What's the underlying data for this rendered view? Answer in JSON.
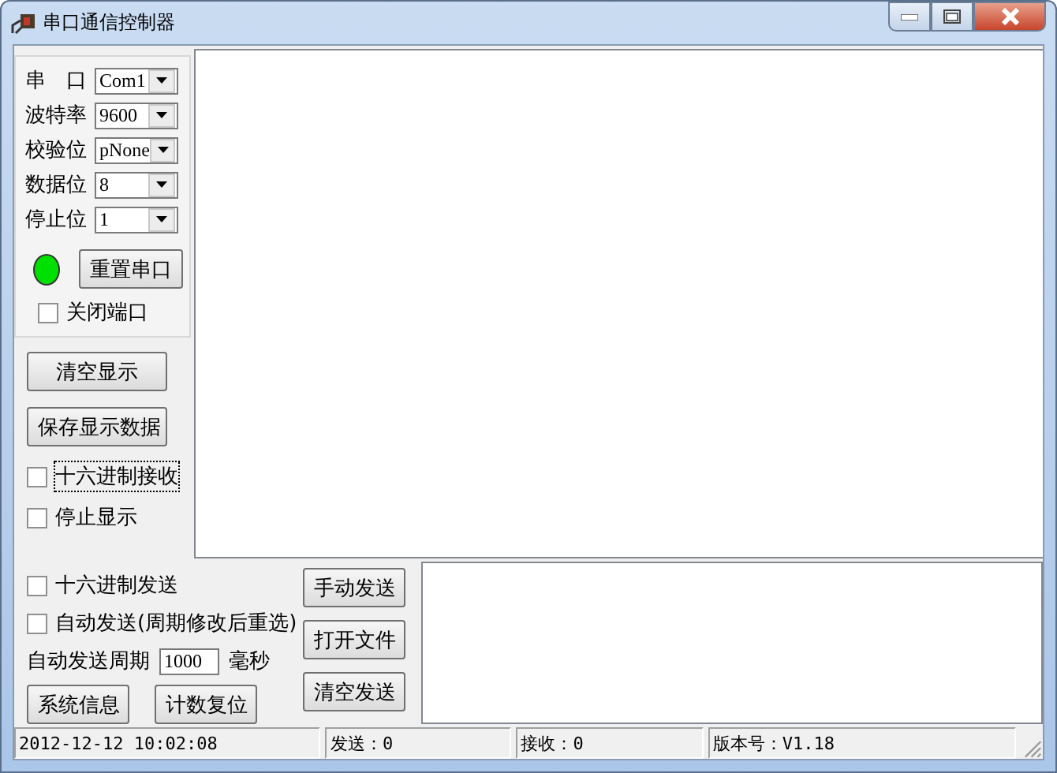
{
  "window": {
    "title": "串口通信控制器"
  },
  "serial_settings": [
    {
      "label": "串　口",
      "value": "Com1"
    },
    {
      "label": "波特率",
      "value": "9600"
    },
    {
      "label": "校验位",
      "value": "pNone"
    },
    {
      "label": "数据位",
      "value": "8"
    },
    {
      "label": "停止位",
      "value": "1"
    }
  ],
  "port_indicator": {
    "on": true
  },
  "reset_button": "重置串口",
  "close_port": {
    "label": "关闭端口",
    "checked": false
  },
  "clear_display_button": "清空显示",
  "save_display_button": "保存显示数据",
  "receive_options": [
    {
      "label": "十六进制接收",
      "checked": false,
      "focused": true
    },
    {
      "label": "停止显示",
      "checked": false,
      "focused": false
    }
  ],
  "send_options": [
    {
      "label": "十六进制发送",
      "checked": false
    },
    {
      "label": "自动发送(周期修改后重选)",
      "checked": false
    }
  ],
  "period": {
    "label": "自动发送周期",
    "value": "1000",
    "unit": "毫秒"
  },
  "manual_send_button": "手动发送",
  "open_file_button": "打开文件",
  "clear_send_button": "清空发送",
  "system_info_button": "系统信息",
  "reset_count_button": "计数复位",
  "status_bar": [
    "2012-12-12 10:02:08",
    "发送：0",
    "接收：0",
    "版本号：V1.18"
  ]
}
